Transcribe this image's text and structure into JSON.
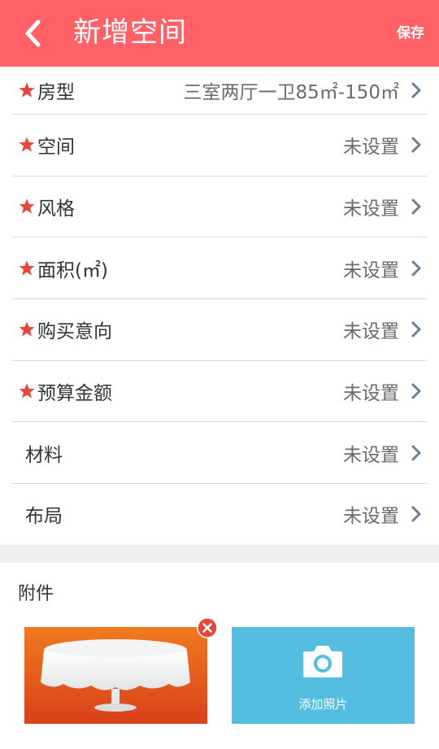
{
  "header": {
    "title": "新增空间",
    "save_label": "保存",
    "bg_color": "#ff6166"
  },
  "fields": [
    {
      "label": "房型",
      "value": "三室两厅一卫85㎡-150㎡",
      "required": true
    },
    {
      "label": "空间",
      "value": "未设置",
      "required": true
    },
    {
      "label": "风格",
      "value": "未设置",
      "required": true
    },
    {
      "label": "面积(㎡)",
      "value": "未设置",
      "required": true
    },
    {
      "label": "购买意向",
      "value": "未设置",
      "required": true
    },
    {
      "label": "预算金额",
      "value": "未设置",
      "required": true
    },
    {
      "label": "材料",
      "value": "未设置",
      "required": false
    },
    {
      "label": "布局",
      "value": "未设置",
      "required": false
    }
  ],
  "attachments": {
    "title": "附件",
    "add_photo_label": "添加照片",
    "accent_color": "#55bde0"
  },
  "colors": {
    "star": "#e8453c",
    "chevron": "#6a7f98",
    "remove": "#e8453c"
  }
}
